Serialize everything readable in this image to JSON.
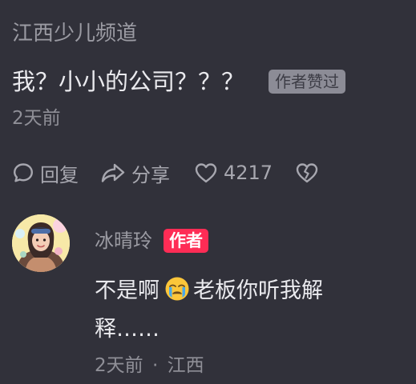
{
  "comment": {
    "username": "江西少儿频道",
    "text": "我？小小的公司？？？",
    "liked_badge": "作者赞过",
    "time": "2天前"
  },
  "actions": {
    "reply_label": "回复",
    "share_label": "分享",
    "like_count": "4217"
  },
  "reply": {
    "avatar_icon": "user-avatar",
    "username": "冰晴玲",
    "author_badge": "作者",
    "text_before": "不是啊",
    "emoji_icon": "crying-face-icon",
    "text_after": "老板你听我解释……",
    "time": "2天前",
    "separator": "·",
    "location": "江西"
  },
  "colors": {
    "background": "#31313a",
    "author_badge": "#fe2c55",
    "liked_badge": "#8c8c96"
  }
}
